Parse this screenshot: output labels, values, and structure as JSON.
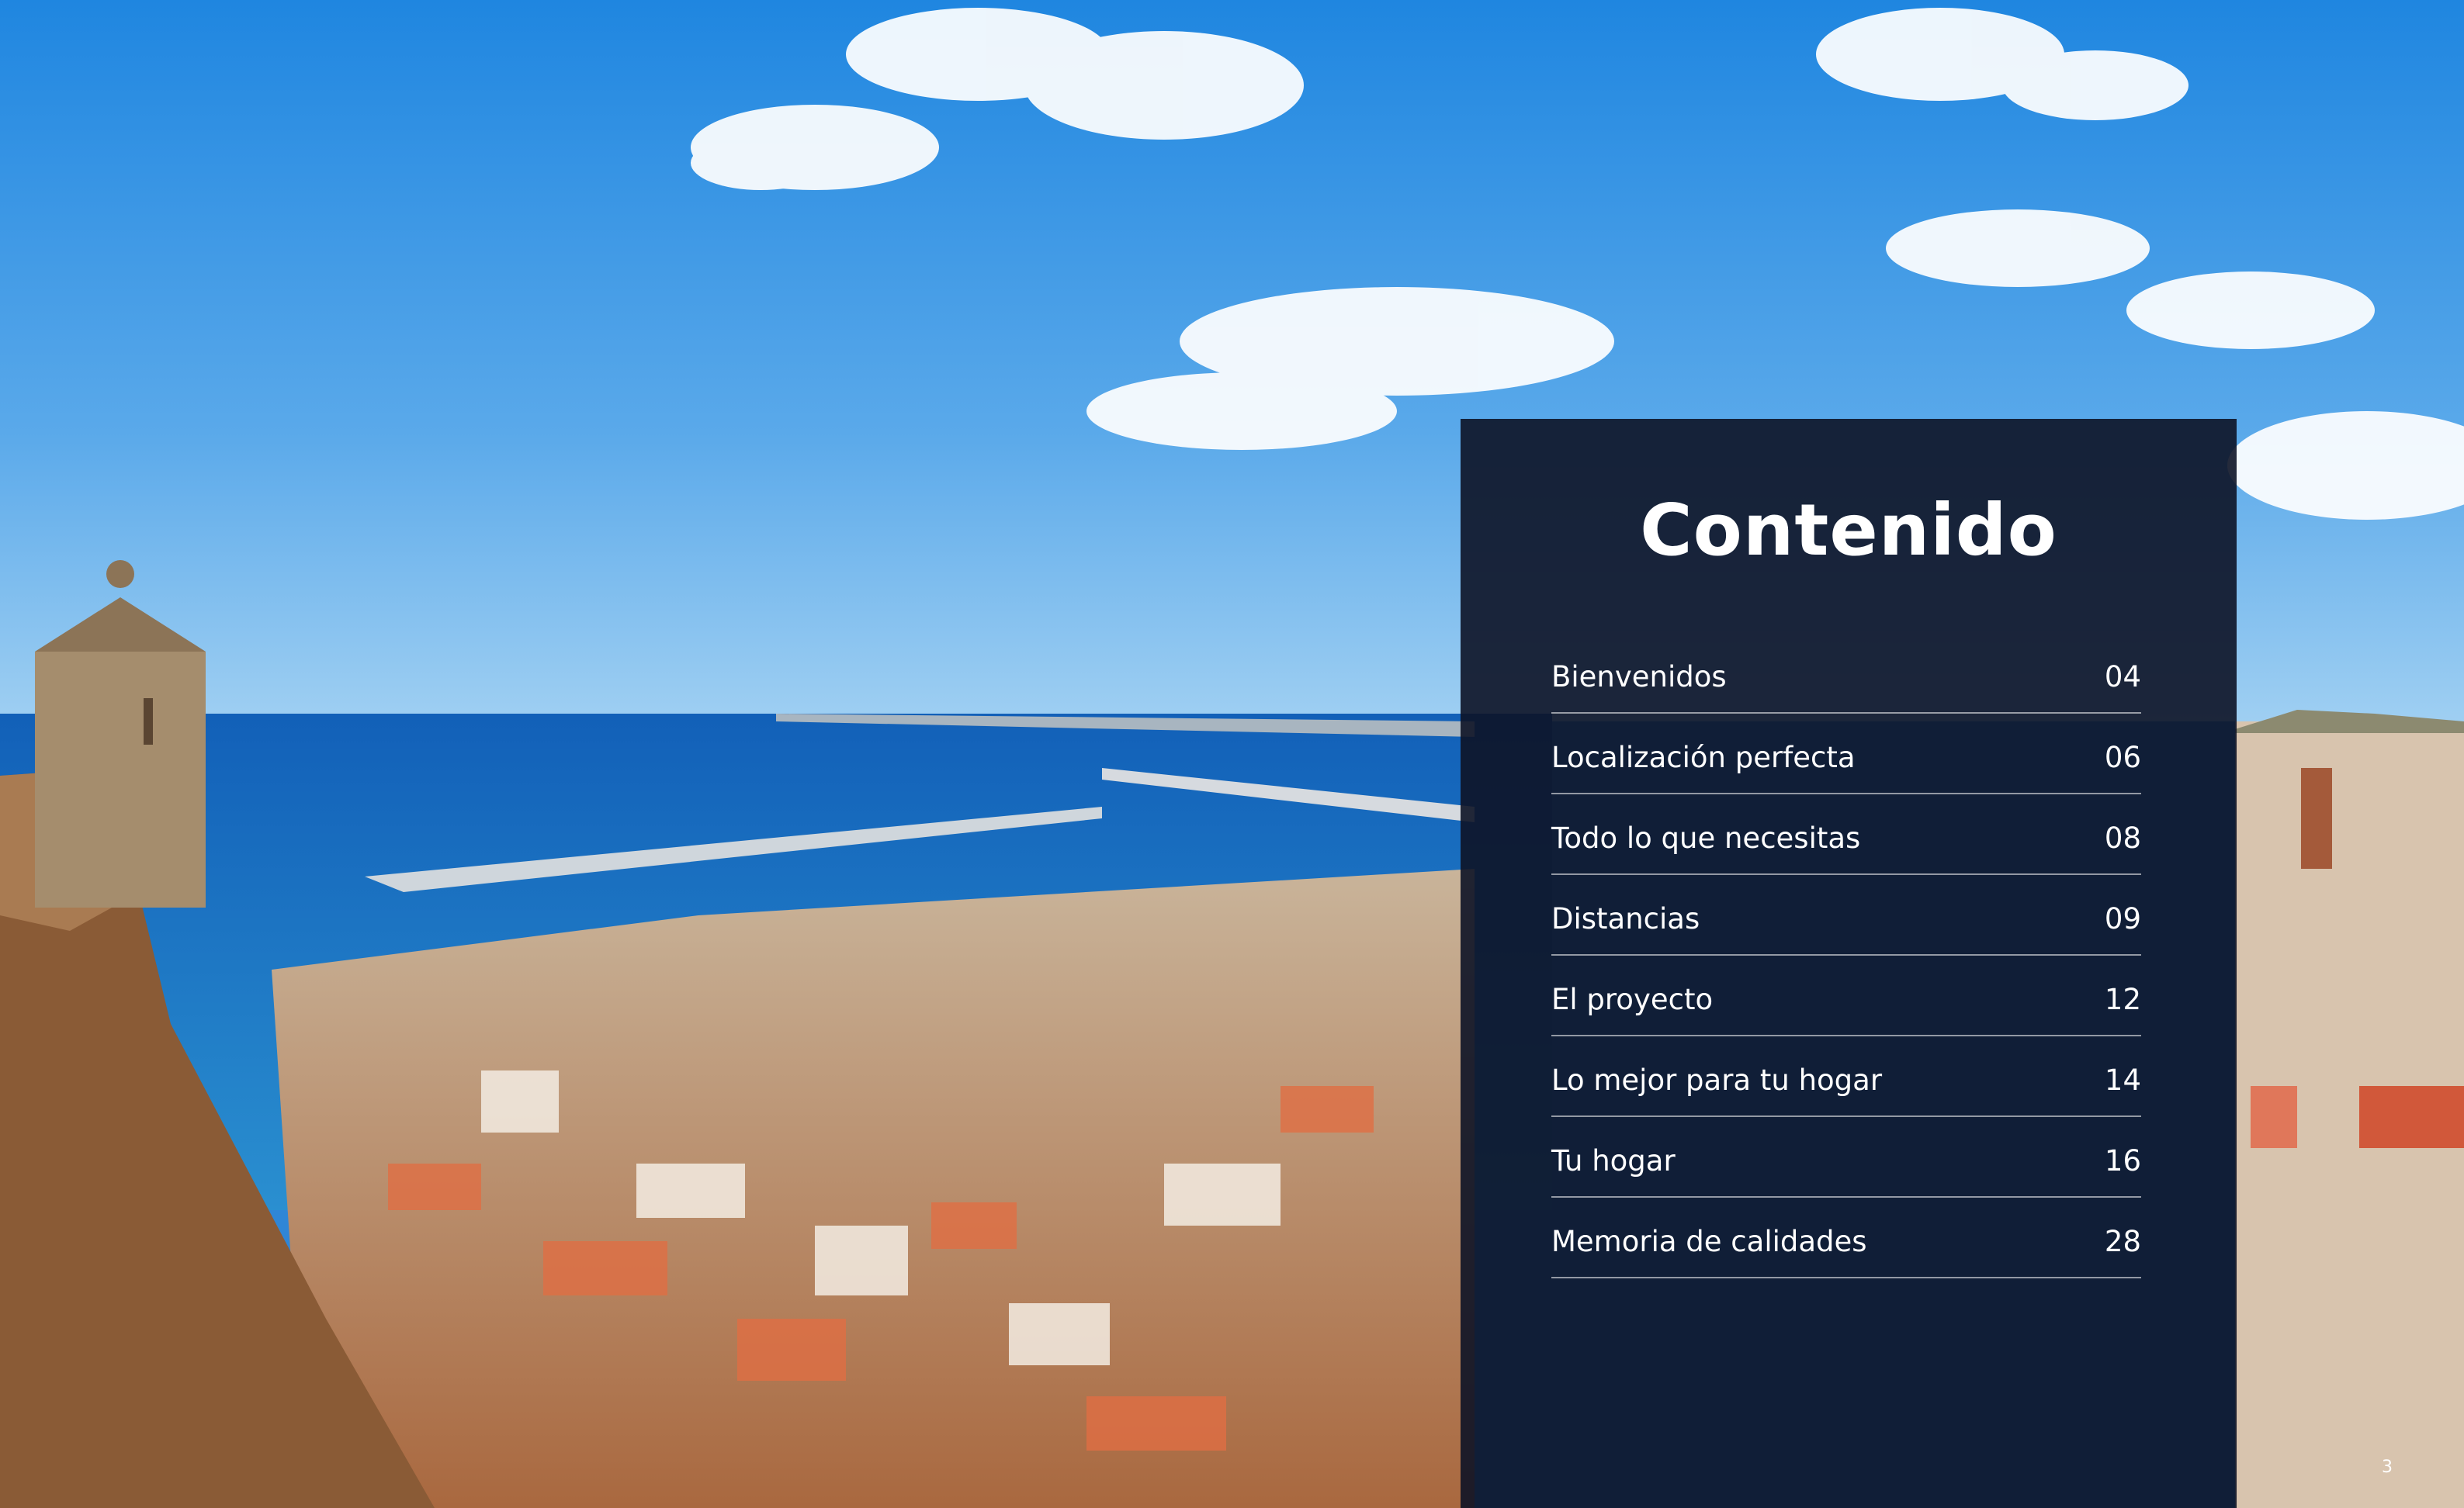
{
  "page": {
    "title": "Contenido",
    "page_number": "3"
  },
  "toc": {
    "items": [
      {
        "label": "Bienvenidos",
        "page": "04"
      },
      {
        "label": "Localización perfecta",
        "page": "06"
      },
      {
        "label": "Todo lo que necesitas",
        "page": "08"
      },
      {
        "label": "Distancias",
        "page": "09"
      },
      {
        "label": "El proyecto",
        "page": "12"
      },
      {
        "label": "Lo mejor para tu hogar",
        "page": "14"
      },
      {
        "label": "Tu hogar",
        "page": "16"
      },
      {
        "label": "Memoria de calidades",
        "page": "28"
      }
    ]
  }
}
